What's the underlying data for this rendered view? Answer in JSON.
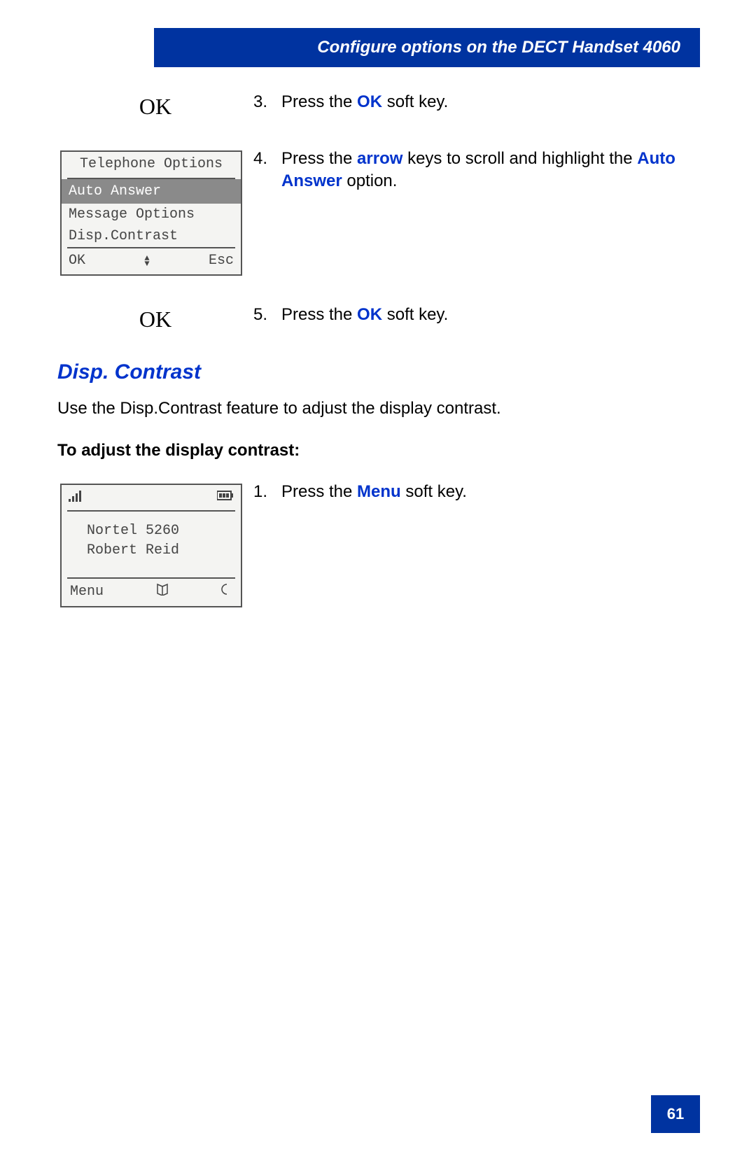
{
  "header": {
    "title": "Configure options on the DECT Handset 4060"
  },
  "steps": {
    "s3": {
      "num": "3.",
      "ok": "OK",
      "pre": "Press the ",
      "key": "OK",
      "post": " soft key."
    },
    "s4": {
      "num": "4.",
      "pre": "Press the ",
      "key1": "arrow",
      "mid": " keys to scroll and highlight the ",
      "key2": "Auto Answer",
      "post": " option."
    },
    "s5": {
      "num": "5.",
      "ok": "OK",
      "pre": "Press the ",
      "key": "OK",
      "post": " soft key."
    },
    "s1b": {
      "num": "1.",
      "pre": "Press the ",
      "key": "Menu",
      "post": " soft key."
    }
  },
  "menu_screen": {
    "title": "Telephone Options",
    "selected": "Auto Answer",
    "item1": "Message Options",
    "item2": "Disp.Contrast",
    "left": "OK",
    "right": "Esc"
  },
  "idle_screen": {
    "line1": "Nortel 5260",
    "line2": "Robert Reid",
    "left": "Menu"
  },
  "section": {
    "heading": "Disp. Contrast",
    "desc": "Use the Disp.Contrast feature to adjust the display contrast.",
    "subheading": "To adjust the display contrast:"
  },
  "page_number": "61"
}
